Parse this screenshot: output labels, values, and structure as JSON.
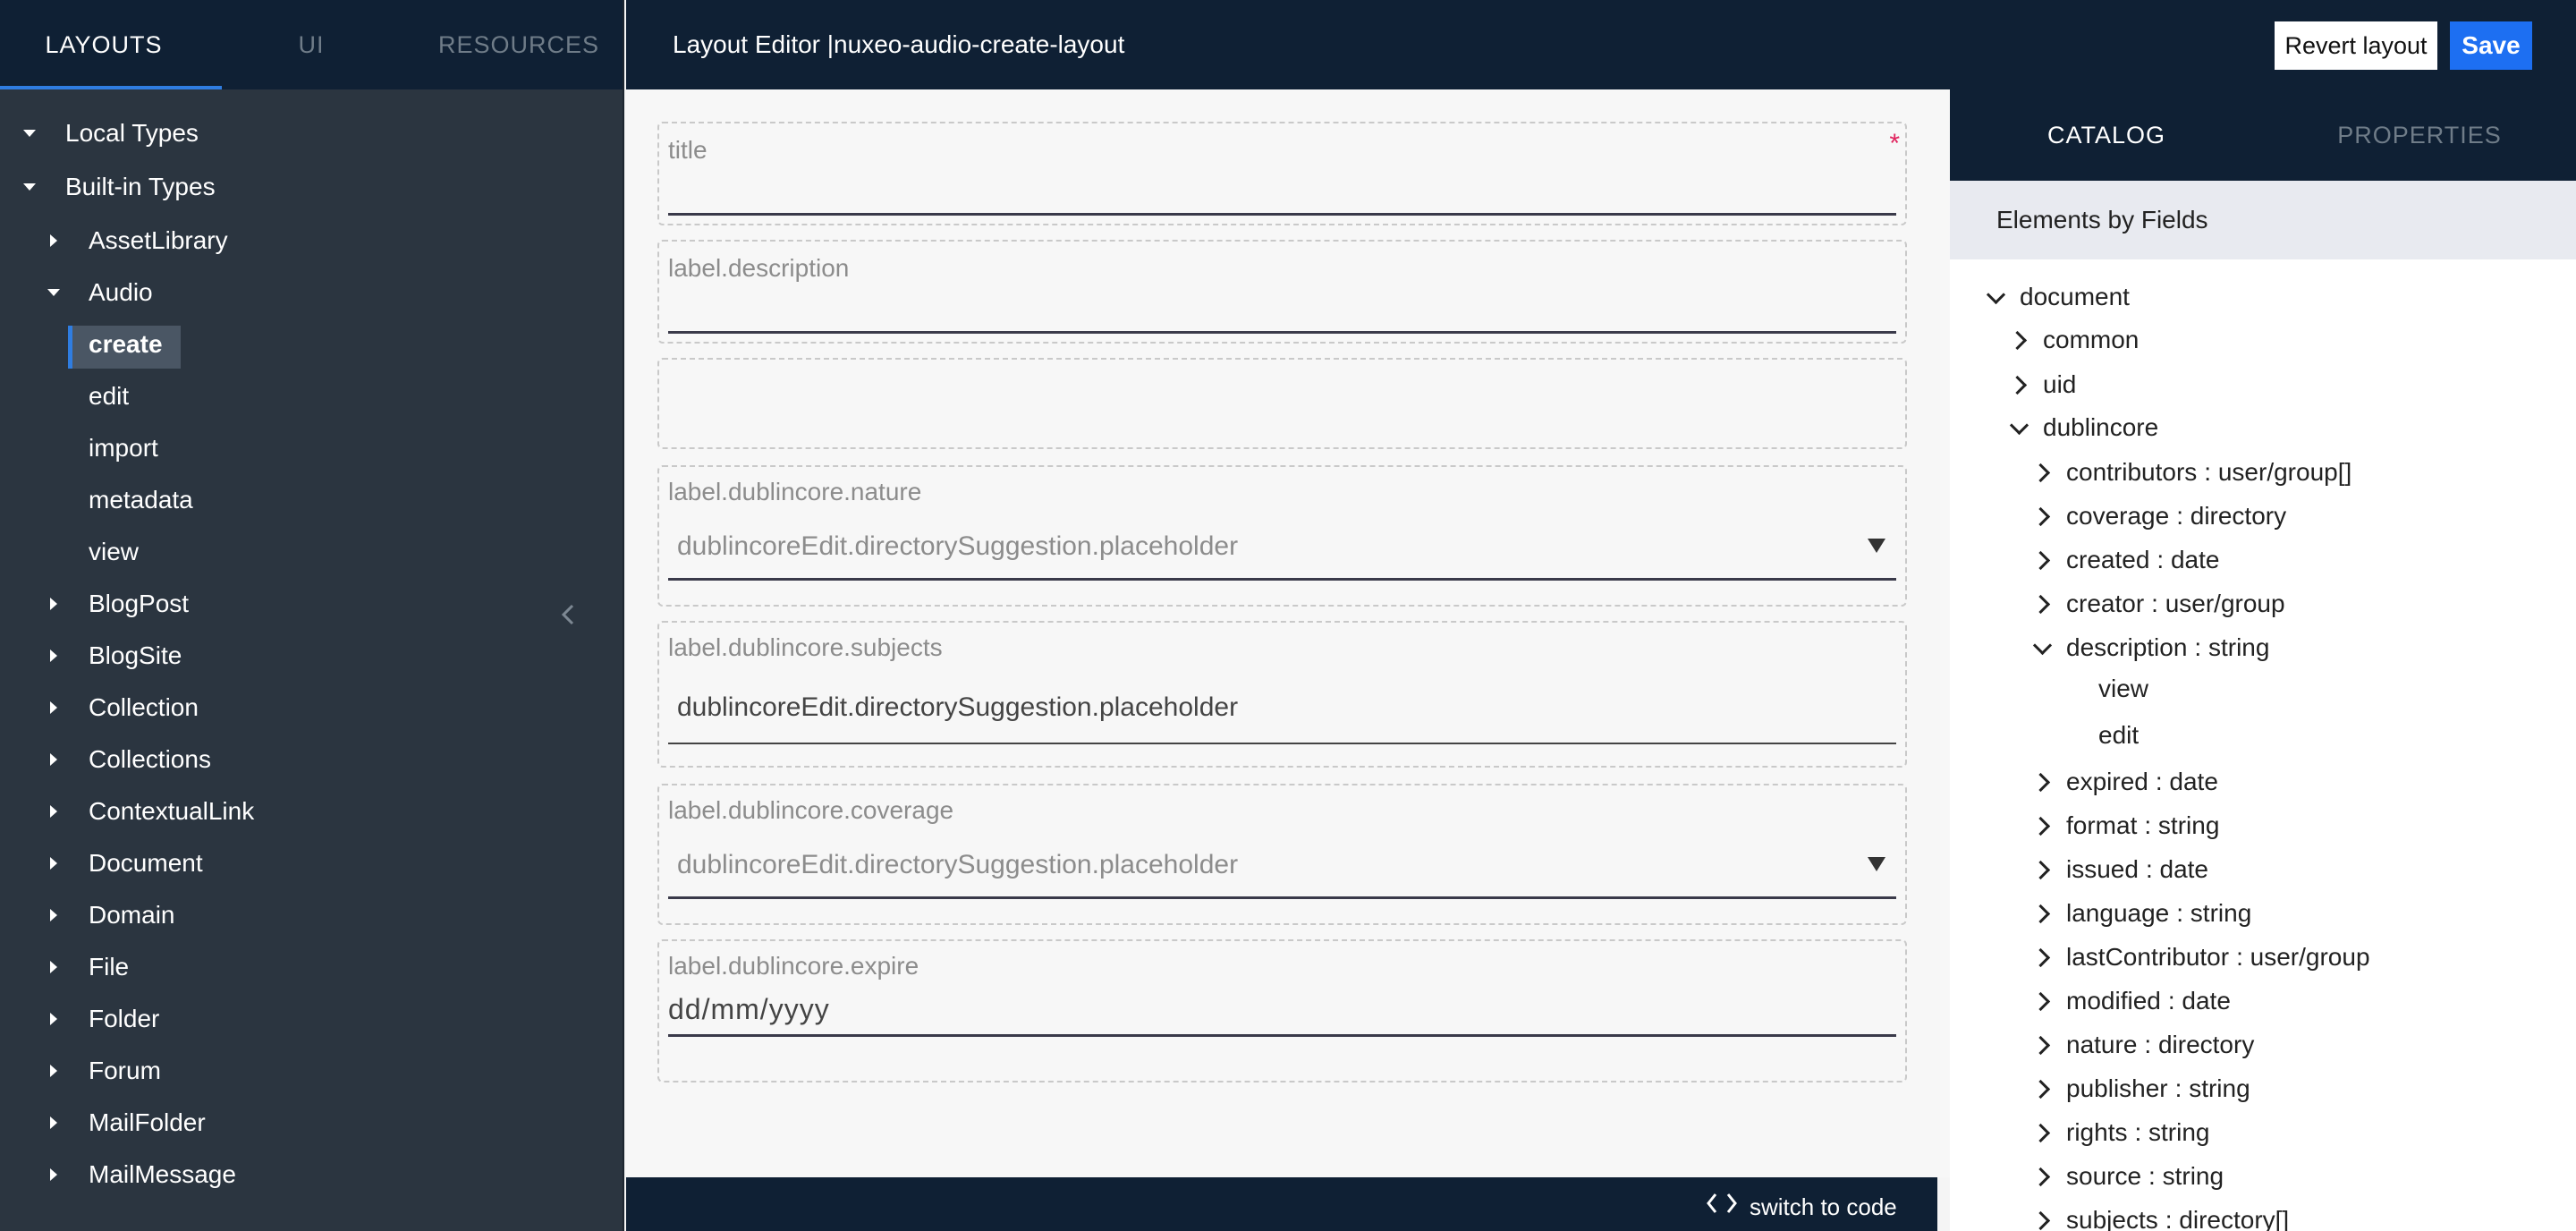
{
  "sidebar": {
    "tabs": [
      "LAYOUTS",
      "UI",
      "RESOURCES"
    ],
    "tree": {
      "local_types": "Local Types",
      "builtin_types": "Built-in Types",
      "asset_library": "AssetLibrary",
      "audio": "Audio",
      "audio_children": [
        "create",
        "edit",
        "import",
        "metadata",
        "view"
      ],
      "others": [
        "BlogPost",
        "BlogSite",
        "Collection",
        "Collections",
        "ContextualLink",
        "Document",
        "Domain",
        "File",
        "Folder",
        "Forum",
        "MailFolder",
        "MailMessage"
      ]
    },
    "collapse_icon": "chevron-left-icon"
  },
  "header": {
    "title": "Layout Editor |nuxeo-audio-create-layout",
    "revert_label": "Revert layout",
    "save_label": "Save"
  },
  "canvas": {
    "fields": {
      "title_label": "title",
      "required_mark": "*",
      "description_label": "label.description",
      "nature_label": "label.dublincore.nature",
      "nature_placeholder": "dublincoreEdit.directorySuggestion.placeholder",
      "subjects_label": "label.dublincore.subjects",
      "subjects_placeholder": "dublincoreEdit.directorySuggestion.placeholder",
      "coverage_label": "label.dublincore.coverage",
      "coverage_placeholder": "dublincoreEdit.directorySuggestion.placeholder",
      "expire_label": "label.dublincore.expire",
      "expire_placeholder": "dd/mm/yyyy"
    },
    "switch_code_label": "switch to code"
  },
  "rpanel": {
    "tabs": [
      "CATALOG",
      "PROPERTIES"
    ],
    "subheader": "Elements by Fields",
    "tree": {
      "document": "document",
      "common": "common",
      "uid": "uid",
      "dublincore": "dublincore",
      "fields": [
        {
          "name": "contributors",
          "type": ": user/group[]"
        },
        {
          "name": "coverage",
          "type": ": directory"
        },
        {
          "name": "created",
          "type": ": date"
        },
        {
          "name": "creator",
          "type": ": user/group"
        },
        {
          "name": "description",
          "type": ": string"
        },
        {
          "name": "expired",
          "type": ": date"
        },
        {
          "name": "format",
          "type": ": string"
        },
        {
          "name": "issued",
          "type": ": date"
        },
        {
          "name": "language",
          "type": ": string"
        },
        {
          "name": "lastContributor",
          "type": ": user/group"
        },
        {
          "name": "modified",
          "type": ": date"
        },
        {
          "name": "nature",
          "type": ": directory"
        },
        {
          "name": "publisher",
          "type": ": string"
        },
        {
          "name": "rights",
          "type": ": string"
        },
        {
          "name": "source",
          "type": ": string"
        },
        {
          "name": "subjects",
          "type": ": directory[]"
        }
      ],
      "description_children": [
        "view",
        "edit"
      ]
    }
  }
}
